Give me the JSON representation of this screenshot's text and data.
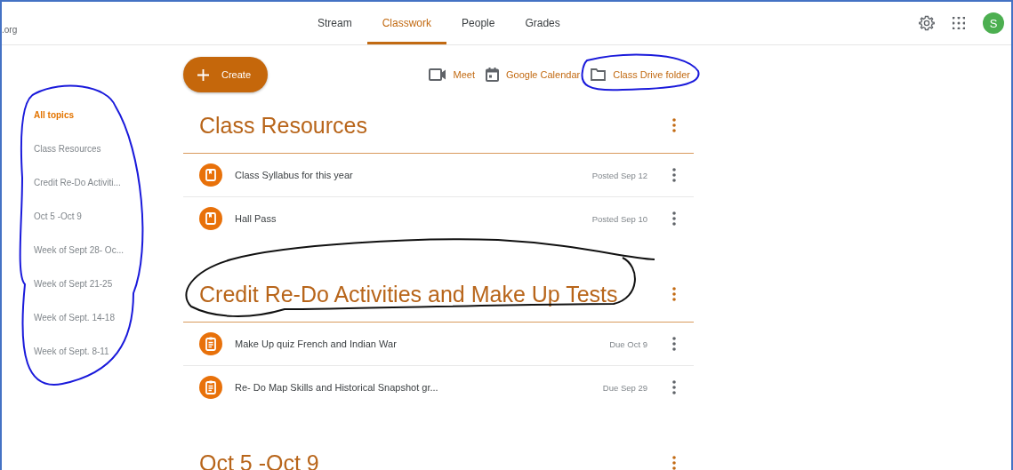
{
  "header": {
    "domain": ".org",
    "tabs": [
      {
        "label": "Stream",
        "selected": false
      },
      {
        "label": "Classwork",
        "selected": true
      },
      {
        "label": "People",
        "selected": false
      },
      {
        "label": "Grades",
        "selected": false
      }
    ],
    "avatar": "S"
  },
  "topics": [
    {
      "label": "All topics",
      "selected": true
    },
    {
      "label": "Class Resources",
      "selected": false
    },
    {
      "label": "Credit Re-Do Activiti...",
      "selected": false
    },
    {
      "label": "Oct 5 -Oct 9",
      "selected": false
    },
    {
      "label": "Week of Sept 28- Oc...",
      "selected": false
    },
    {
      "label": "Week of Sept 21-25",
      "selected": false
    },
    {
      "label": "Week of Sept. 14-18",
      "selected": false
    },
    {
      "label": "Week of Sept. 8-11",
      "selected": false
    }
  ],
  "create_button": "Create",
  "links": [
    {
      "kind": "meet",
      "label": "Meet"
    },
    {
      "kind": "calendar",
      "label": "Google Calendar"
    },
    {
      "kind": "folder",
      "label": "Class Drive folder"
    }
  ],
  "sections": [
    {
      "title": "Class Resources",
      "items": [
        {
          "kind": "material",
          "title": "Class Syllabus for this year",
          "date": "Posted Sep 12"
        },
        {
          "kind": "material",
          "title": "Hall Pass",
          "date": "Posted Sep 10"
        }
      ]
    },
    {
      "title": "Credit Re-Do Activities and Make Up Tests",
      "items": [
        {
          "kind": "assignment",
          "title": "Make Up quiz French and Indian War",
          "date": "Due Oct 9"
        },
        {
          "kind": "assignment",
          "title": "Re- Do Map Skills and Historical Snapshot gr...",
          "date": "Due Sep 29"
        }
      ]
    },
    {
      "title": "Oct 5 -Oct 9"
    }
  ]
}
